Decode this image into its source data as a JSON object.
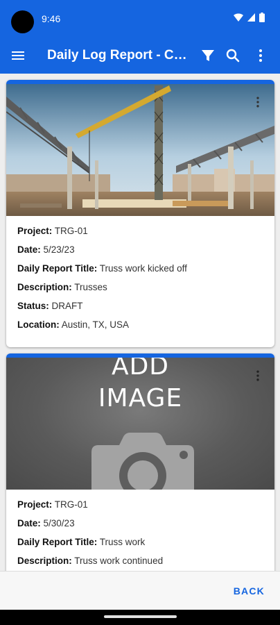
{
  "status_bar": {
    "time": "9:46"
  },
  "app_bar": {
    "title": "Daily Log Report - Car...",
    "icons": [
      "menu-icon",
      "filter-icon",
      "search-icon",
      "more-vert-icon"
    ]
  },
  "reports": [
    {
      "image": "construction-site-photo",
      "fields": [
        {
          "label": "Project:",
          "value": "TRG-01"
        },
        {
          "label": "Date:",
          "value": "5/23/23"
        },
        {
          "label": "Daily Report Title:",
          "value": "Truss work kicked off"
        },
        {
          "label": "Description:",
          "value": "Trusses"
        },
        {
          "label": "Status:",
          "value": "DRAFT"
        },
        {
          "label": "Location:",
          "value": "Austin, TX, USA"
        }
      ]
    },
    {
      "image": "add-image-placeholder",
      "placeholder_line1": "ADD",
      "placeholder_line2": "IMAGE",
      "fields": [
        {
          "label": "Project:",
          "value": "TRG-01"
        },
        {
          "label": "Date:",
          "value": "5/30/23"
        },
        {
          "label": "Daily Report Title:",
          "value": "Truss work"
        },
        {
          "label": "Description:",
          "value": "Truss work continued"
        }
      ]
    }
  ],
  "footer": {
    "back_label": "BACK"
  },
  "colors": {
    "primary": "#1565e0",
    "placeholder_bg": "#5a5a5a"
  }
}
